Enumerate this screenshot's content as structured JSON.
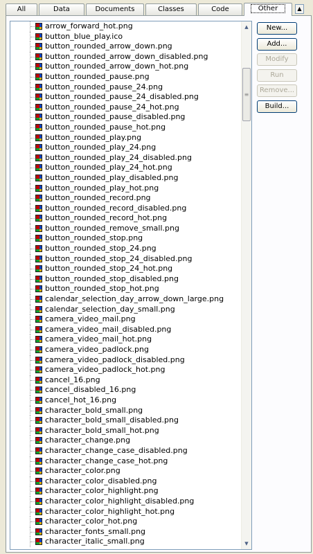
{
  "tabs": [
    "All",
    "Data",
    "Documents",
    "Classes",
    "Code",
    "Other"
  ],
  "active_tab": "Other",
  "buttons": {
    "new": "New...",
    "add": "Add...",
    "modify": "Modify",
    "run": "Run",
    "remove": "Remove...",
    "build": "Build..."
  },
  "files": [
    "arrow_forward_hot.png",
    "button_blue_play.ico",
    "button_rounded_arrow_down.png",
    "button_rounded_arrow_down_disabled.png",
    "button_rounded_arrow_down_hot.png",
    "button_rounded_pause.png",
    "button_rounded_pause_24.png",
    "button_rounded_pause_24_disabled.png",
    "button_rounded_pause_24_hot.png",
    "button_rounded_pause_disabled.png",
    "button_rounded_pause_hot.png",
    "button_rounded_play.png",
    "button_rounded_play_24.png",
    "button_rounded_play_24_disabled.png",
    "button_rounded_play_24_hot.png",
    "button_rounded_play_disabled.png",
    "button_rounded_play_hot.png",
    "button_rounded_record.png",
    "button_rounded_record_disabled.png",
    "button_rounded_record_hot.png",
    "button_rounded_remove_small.png",
    "button_rounded_stop.png",
    "button_rounded_stop_24.png",
    "button_rounded_stop_24_disabled.png",
    "button_rounded_stop_24_hot.png",
    "button_rounded_stop_disabled.png",
    "button_rounded_stop_hot.png",
    "calendar_selection_day_arrow_down_large.png",
    "calendar_selection_day_small.png",
    "camera_video_mail.png",
    "camera_video_mail_disabled.png",
    "camera_video_mail_hot.png",
    "camera_video_padlock.png",
    "camera_video_padlock_disabled.png",
    "camera_video_padlock_hot.png",
    "cancel_16.png",
    "cancel_disabled_16.png",
    "cancel_hot_16.png",
    "character_bold_small.png",
    "character_bold_small_disabled.png",
    "character_bold_small_hot.png",
    "character_change.png",
    "character_change_case_disabled.png",
    "character_change_case_hot.png",
    "character_color.png",
    "character_color_disabled.png",
    "character_color_highlight.png",
    "character_color_highlight_disabled.png",
    "character_color_highlight_hot.png",
    "character_color_hot.png",
    "character_fonts_small.png",
    "character_italic_small.png"
  ]
}
